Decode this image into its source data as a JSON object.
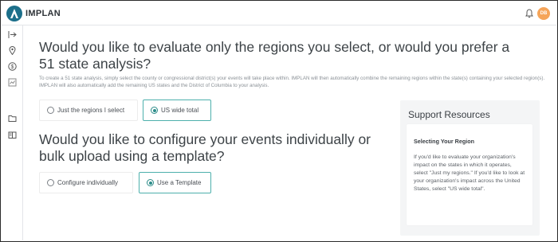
{
  "app": {
    "brand": "IMPLAN",
    "user_initials": "DB",
    "brand_color": "#1c6f8a",
    "accent_color": "#2c8c89",
    "avatar_color": "#f5a55a"
  },
  "rail": {
    "items": [
      {
        "icon": "expand-arrow-icon"
      },
      {
        "icon": "location-pin-icon"
      },
      {
        "icon": "dollar-icon"
      },
      {
        "icon": "chart-icon"
      },
      {
        "icon": "folder-icon"
      },
      {
        "icon": "book-icon"
      }
    ]
  },
  "section1": {
    "title": "Would you like to evaluate only the regions you select, or would you prefer a 51 state analysis?",
    "description": "To create a 51 state analysis, simply select the county or congressional district(s) your events will take place within. IMPLAN will then automatically combine the remaining regions within the state(s) containing your selected region(s). IMPLAN will also automatically add the remaining US states and the District of Columbia to your analysis.",
    "options": [
      {
        "label": "Just the regions I select",
        "selected": false
      },
      {
        "label": "US wide total",
        "selected": true
      }
    ]
  },
  "section2": {
    "title": "Would you like to configure your events individually or bulk upload using a template?",
    "options": [
      {
        "label": "Configure individually",
        "selected": false
      },
      {
        "label": "Use a Template",
        "selected": true
      }
    ]
  },
  "support": {
    "title": "Support Resources",
    "card_heading": "Selecting Your Region",
    "card_body": "If you'd like to evaluate your organization's impact on the states in which it operates, select \"Just my regions.\" If you'd like to look at your organization's impact across the United States, select \"US wide total\"."
  }
}
